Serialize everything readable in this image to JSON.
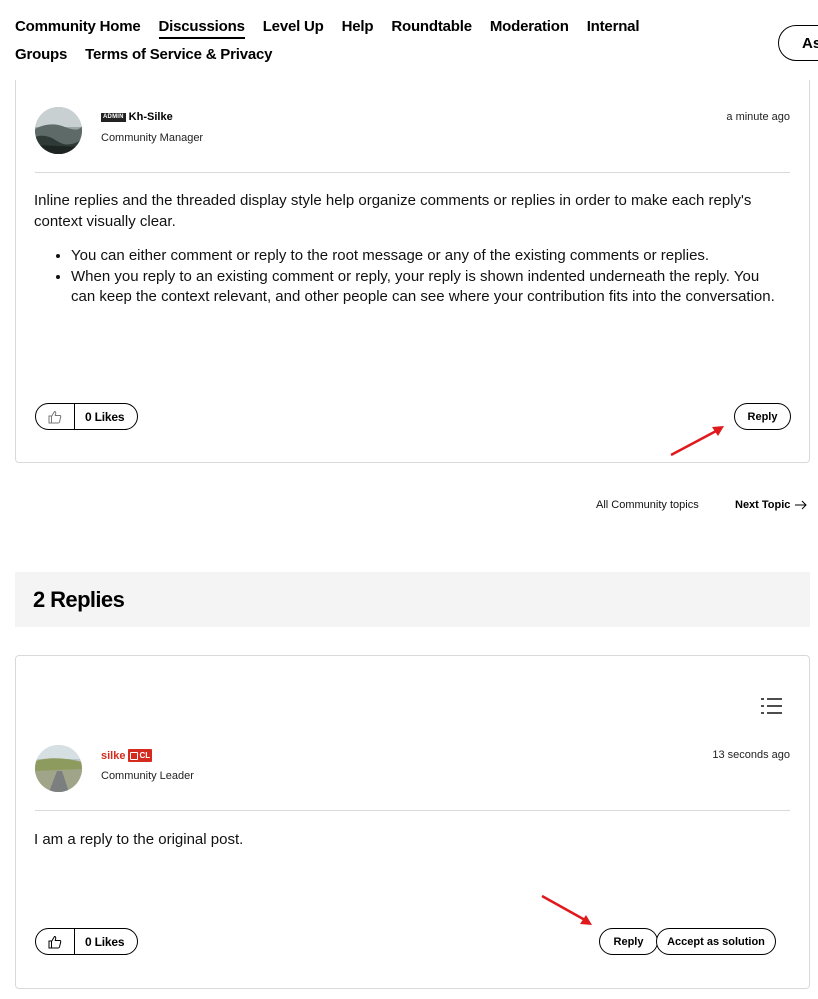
{
  "nav": {
    "items": [
      {
        "label": "Community Home",
        "active": false
      },
      {
        "label": "Discussions",
        "active": true
      },
      {
        "label": "Level Up",
        "active": false
      },
      {
        "label": "Help",
        "active": false
      },
      {
        "label": "Roundtable",
        "active": false
      },
      {
        "label": "Moderation",
        "active": false
      },
      {
        "label": "Internal",
        "active": false
      },
      {
        "label": "Groups",
        "active": false
      },
      {
        "label": "Terms of Service & Privacy",
        "active": false
      }
    ],
    "ask_label": "As"
  },
  "main_post": {
    "badge": "ADMIN",
    "author": "Kh-Silke",
    "role": "Community Manager",
    "time": "a minute ago",
    "paragraph": "Inline replies and the threaded display style help organize comments or replies in order to make each reply's context visually clear.",
    "bullets": [
      "You can either comment or reply to the root message or any of the existing comments or replies.",
      "When you reply to an existing comment or reply, your reply is shown indented underneath the reply. You can keep the context relevant, and other people can see where your contribution fits into the conversation."
    ],
    "likes": "0 Likes",
    "reply_label": "Reply"
  },
  "topic_nav": {
    "all_topics": "All Community topics",
    "next_topic": "Next Topic"
  },
  "replies": {
    "heading": "2 Replies",
    "items": [
      {
        "author": "silke",
        "badge": "CL",
        "role": "Community Leader",
        "time": "13 seconds ago",
        "body": "I am a reply to the original post.",
        "likes": "0 Likes",
        "reply_label": "Reply",
        "accept_label": "Accept as solution"
      }
    ]
  },
  "colors": {
    "accent_red": "#d52b1e",
    "annotation_arrow": "#e0191c",
    "border": "#d8dada",
    "header_bg": "#f4f4f4"
  },
  "icons": [
    "thumbs-up-icon",
    "arrow-right-icon",
    "menu-list-icon",
    "annotation-arrow-icon"
  ]
}
